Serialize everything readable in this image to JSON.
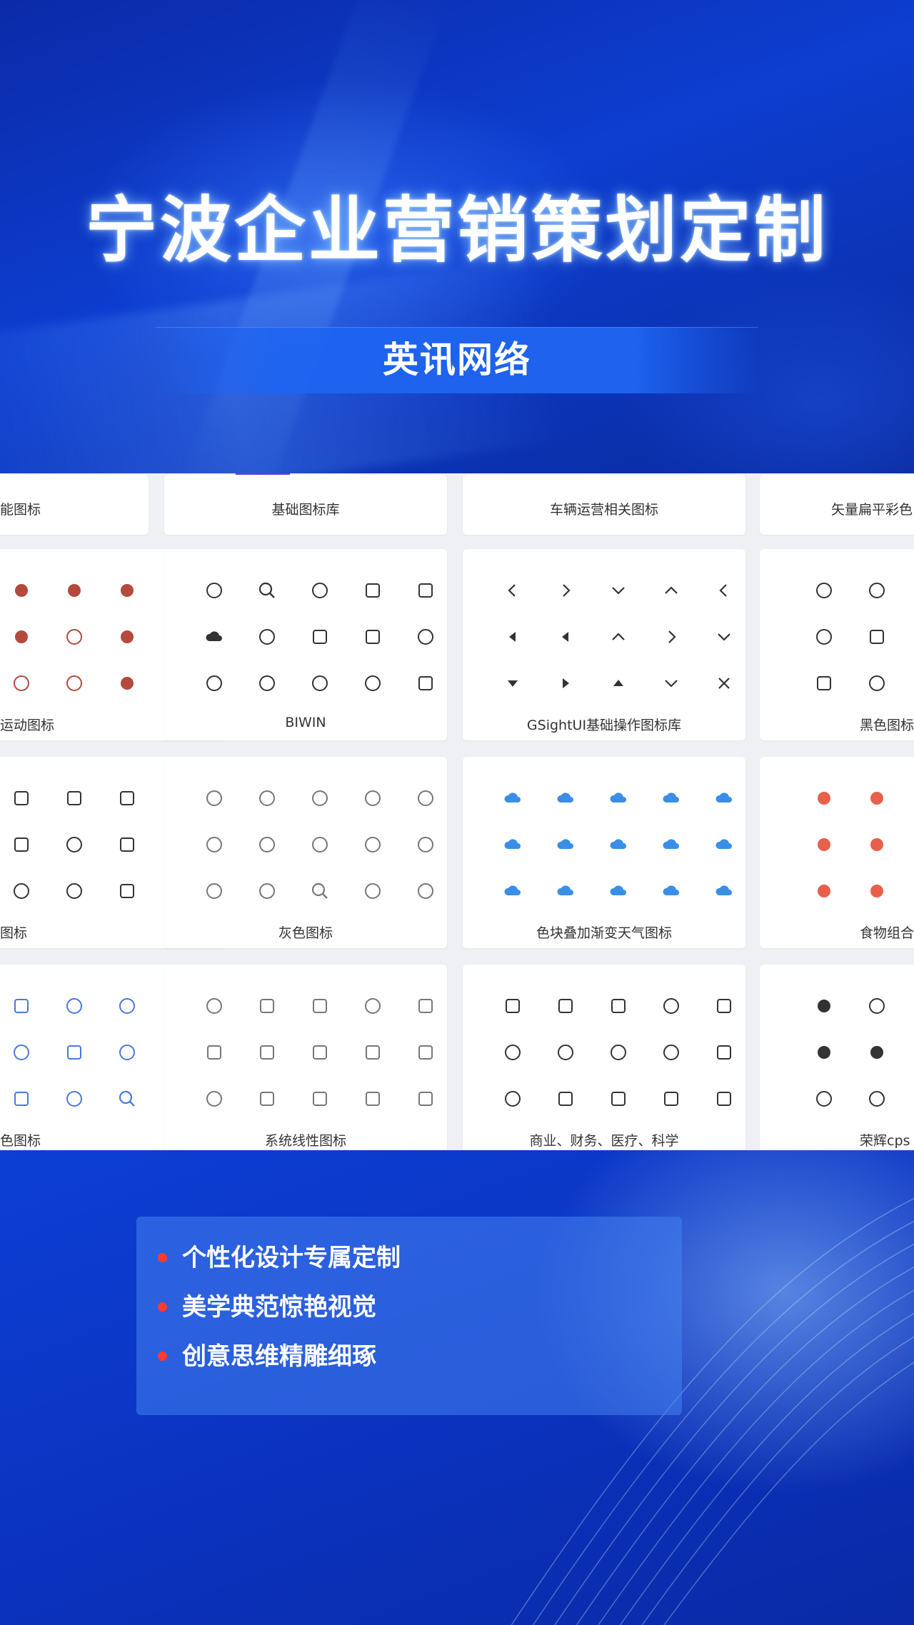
{
  "hero": {
    "title": "宁波企业营销策划定制",
    "subtitle": "英讯网络"
  },
  "top_cards": [
    {
      "label": "能图标"
    },
    {
      "label": "基础图标库"
    },
    {
      "label": "车辆运营相关图标"
    },
    {
      "label": "矢量扁平彩色"
    }
  ],
  "icon_cards": [
    {
      "label": "运动图标",
      "icons": [
        "soccer-ball-icon",
        "tennis-ball-icon",
        "football-icon",
        "heart-ball-icon",
        "racket-icon",
        "dotted-ball-icon",
        "badminton-icon",
        "ping-pong-icon",
        "globe-ball-icon"
      ]
    },
    {
      "label": "BIWIN",
      "icons": [
        "signal-icon",
        "search-icon",
        "globe-icon",
        "monitor-icon",
        "chip-icon",
        "cloud-icon",
        "watch-icon",
        "card-icon",
        "image-icon",
        "pen-icon",
        "car-icon",
        "atom-icon",
        "battery-icon",
        "tree-icon",
        "screen-icon"
      ]
    },
    {
      "label": "GSightUI基础操作图标库",
      "icons": [
        "chevron-left-icon",
        "chevron-right-icon",
        "chevron-down-icon",
        "chevron-up-icon",
        "arrow-left-small-icon",
        "triangle-left-icon",
        "double-left-icon",
        "double-up-icon",
        "arrow-right-small-icon",
        "double-down-icon",
        "triangle-down-icon",
        "triangle-right-icon",
        "triangle-up-icon",
        "download-line-icon",
        "close-icon"
      ]
    },
    {
      "label": "黑色图标",
      "icons": [
        "pie-icon",
        "share-icon",
        "lock-icon",
        "location-icon",
        "building-icon",
        "edit-icon",
        "document-icon",
        "rocket-icon",
        "shield-icon"
      ]
    },
    {
      "label": "图标",
      "icons": [
        "badge-16-icon",
        "badge-256-icon",
        "badge-12-icon",
        "badge-2k-icon",
        "rss-icon",
        "edit-box-icon",
        "target-icon",
        "battery-icon",
        "box-icon"
      ]
    },
    {
      "label": "灰色图标",
      "icons": [
        "thumb-up-icon",
        "medal-icon",
        "smile-icon",
        "pin-icon",
        "headset-icon",
        "check-circle-icon",
        "share-out-icon",
        "mic-icon",
        "cancel-circle-icon",
        "message-icon",
        "gender-icon",
        "flame-icon",
        "search-circle-icon",
        "send-icon",
        "history-icon"
      ]
    },
    {
      "label": "色块叠加渐变天气图标",
      "icons": [
        "rain-cloud-icon",
        "rain-cloud-icon",
        "rain-cloud-icon",
        "rain-cloud-icon",
        "sun-cloud-icon",
        "snow-cloud-icon",
        "cloud-icon",
        "rain-cloud-icon",
        "wind-icon",
        "cloud-icon",
        "rain-cloud-icon",
        "drizzle-icon",
        "snow-cloud-icon",
        "rain-cloud-icon",
        "thunder-cloud-icon"
      ]
    },
    {
      "label": "食物组合",
      "icons": [
        "cherry-icon",
        "star-fruit-icon",
        "grape-icon",
        "cake-icon",
        "ice-cream-icon",
        "bread-icon",
        "meat-icon",
        "donut-icon",
        "corn-icon"
      ]
    },
    {
      "label": "色图标",
      "icons": [
        "monitor-icon",
        "sliders-icon",
        "sliders-alt-icon",
        "share-nodes-icon",
        "document-icon",
        "play-icon",
        "calendar-icon",
        "lock-icon",
        "chart-search-icon"
      ]
    },
    {
      "label": "系统线性图标",
      "icons": [
        "chart-icon",
        "home-icon",
        "apps-icon",
        "warning-icon",
        "cube-icon",
        "stamp-icon",
        "bag-icon",
        "book-icon",
        "calendar-icon",
        "card-icon",
        "user-icon",
        "building-icon",
        "file-icon",
        "note-icon",
        "list-icon"
      ]
    },
    {
      "label": "商业、财务、医疗、科学",
      "icons": [
        "report-icon",
        "upload-box-icon",
        "bookmark-icon",
        "pen-icon",
        "scan-icon",
        "syringe-icon",
        "timer-icon",
        "hospital-icon",
        "pie-chart-icon",
        "tag-icon",
        "plug-icon",
        "money-icon",
        "safe-icon",
        "store-icon",
        "export-icon"
      ]
    },
    {
      "label": "荣辉cps",
      "icons": [
        "chat-fill-icon",
        "chat-icon",
        "note-icon",
        "apps-fill-icon",
        "apps-fill-icon",
        "clock-icon",
        "person-icon",
        "hierarchy-icon",
        "org-chart-icon"
      ]
    }
  ],
  "features": {
    "items": [
      "个性化设计专属定制",
      "美学典范惊艳视觉",
      "创意思维精雕细琢"
    ]
  },
  "colors": {
    "primary_blue": "#0d3ed0",
    "bullet_red": "#ff3b30",
    "tab_indicator": "#5b47d6",
    "weather_blue": "#3a8ee8"
  }
}
